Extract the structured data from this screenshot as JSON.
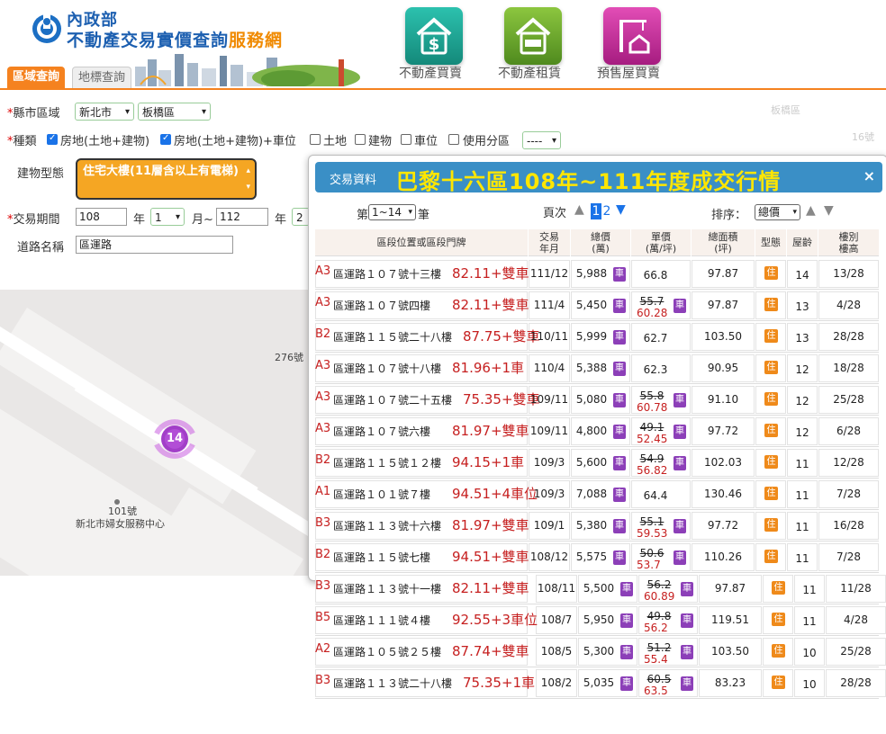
{
  "header": {
    "ministry": "內政部",
    "site_title_main": "不動產交易實價查詢",
    "site_title_suffix": "服務網",
    "categories": [
      {
        "label": "不動產買賣",
        "color": "#1aa08f"
      },
      {
        "label": "不動產租賃",
        "color": "#6aa624"
      },
      {
        "label": "預售屋買賣",
        "color": "#c9339d"
      }
    ],
    "tabs": [
      "區域查詢",
      "地標查詢"
    ]
  },
  "form": {
    "region_label": "縣市區域",
    "city": "新北市",
    "district": "板橋區",
    "type_label": "種類",
    "types": [
      {
        "label": "房地(土地+建物)",
        "checked": true
      },
      {
        "label": "房地(土地+建物)+車位",
        "checked": true
      },
      {
        "label": "土地",
        "checked": false
      },
      {
        "label": "建物",
        "checked": false
      },
      {
        "label": "車位",
        "checked": false
      },
      {
        "label": "使用分區",
        "checked": false
      }
    ],
    "zoning_value": "----",
    "building_type_label": "建物型態",
    "building_type_value": "住宅大樓(11層含以上有電梯)",
    "period_label": "交易期間",
    "period_start_year": "108",
    "period_year_unit": "年",
    "period_start_month": "1",
    "period_month_unit": "月~",
    "period_end_year": "112",
    "period_end_year_unit": "年",
    "period_end_month": "2",
    "road_label": "道路名稱",
    "road_value": "區運路"
  },
  "map": {
    "labels": [
      "276號",
      "101號",
      "新北市婦女服務中心"
    ],
    "cluster_count": "14",
    "faded_labels": [
      "板橋區",
      "16號"
    ]
  },
  "popup": {
    "tag": "交易資料",
    "title": "巴黎十六區108年~111年度成交行情",
    "close": "×",
    "range_prefix": "第",
    "range_value": "1~14",
    "range_suffix": "筆",
    "page_label": "頁次",
    "pages": [
      "1",
      "2"
    ],
    "sort_label": "排序：",
    "sort_value": "總價",
    "car_badge": "車",
    "res_badge": "住",
    "headers": [
      "區段位置或區段門牌",
      "交易\n年月",
      "總價\n(萬)",
      "單價\n(萬/坪)",
      "總面積\n(坪)",
      "型態",
      "屋齡",
      "樓別\n樓高"
    ],
    "rows": [
      {
        "code": "A3",
        "addr": "區運路１０７號十三樓",
        "ping": "82.11+雙車",
        "date": "111/12",
        "total": "5,988",
        "unit_orig": "66.8",
        "unit_adj": "",
        "area": "97.87",
        "age": "14",
        "floor": "13/28"
      },
      {
        "code": "A3",
        "addr": "區運路１０７號四樓",
        "ping": "82.11+雙車",
        "date": "111/4",
        "total": "5,450",
        "unit_orig": "55.7",
        "unit_adj": "60.28",
        "area": "97.87",
        "age": "13",
        "floor": "4/28"
      },
      {
        "code": "B2",
        "addr": "區運路１１５號二十八樓",
        "ping": "87.75+雙車",
        "date": "110/11",
        "total": "5,999",
        "unit_orig": "62.7",
        "unit_adj": "",
        "area": "103.50",
        "age": "13",
        "floor": "28/28"
      },
      {
        "code": "A3",
        "addr": "區運路１０７號十八樓",
        "ping": "81.96+1車",
        "date": "110/4",
        "total": "5,388",
        "unit_orig": "62.3",
        "unit_adj": "",
        "area": "90.95",
        "age": "12",
        "floor": "18/28"
      },
      {
        "code": "A3",
        "addr": "區運路１０７號二十五樓",
        "ping": "75.35+雙車",
        "date": "109/11",
        "total": "5,080",
        "unit_orig": "55.8",
        "unit_adj": "60.78",
        "area": "91.10",
        "age": "12",
        "floor": "25/28"
      },
      {
        "code": "A3",
        "addr": "區運路１０７號六樓",
        "ping": "81.97+雙車",
        "date": "109/11",
        "total": "4,800",
        "unit_orig": "49.1",
        "unit_adj": "52.45",
        "area": "97.72",
        "age": "12",
        "floor": "6/28"
      },
      {
        "code": "B2",
        "addr": "區運路１１５號１２樓",
        "ping": "94.15+1車",
        "date": "109/3",
        "total": "5,600",
        "unit_orig": "54.9",
        "unit_adj": "56.82",
        "area": "102.03",
        "age": "11",
        "floor": "12/28"
      },
      {
        "code": "A1",
        "addr": "區運路１０１號７樓",
        "ping": "94.51+4車位",
        "date": "109/3",
        "total": "7,088",
        "unit_orig": "64.4",
        "unit_adj": "",
        "area": "130.46",
        "age": "11",
        "floor": "7/28"
      },
      {
        "code": "B3",
        "addr": "區運路１１３號十六樓",
        "ping": "81.97+雙車",
        "date": "109/1",
        "total": "5,380",
        "unit_orig": "55.1",
        "unit_adj": "59.53",
        "area": "97.72",
        "age": "11",
        "floor": "16/28"
      },
      {
        "code": "B2",
        "addr": "區運路１１５號七樓",
        "ping": "94.51+雙車",
        "date": "108/12",
        "total": "5,575",
        "unit_orig": "50.6",
        "unit_adj": "53.7",
        "area": "110.26",
        "age": "11",
        "floor": "7/28"
      },
      {
        "code": "B3",
        "addr": "區運路１１３號十一樓",
        "ping": "82.11+雙車",
        "date": "108/11",
        "total": "5,500",
        "unit_orig": "56.2",
        "unit_adj": "60.89",
        "area": "97.87",
        "age": "11",
        "floor": "11/28"
      },
      {
        "code": "B5",
        "addr": "區運路１１１號４樓",
        "ping": "92.55+3車位",
        "date": "108/7",
        "total": "5,950",
        "unit_orig": "49.8",
        "unit_adj": "56.2",
        "area": "119.51",
        "age": "11",
        "floor": "4/28"
      },
      {
        "code": "A2",
        "addr": "區運路１０５號２５樓",
        "ping": "87.74+雙車",
        "date": "108/5",
        "total": "5,300",
        "unit_orig": "51.2",
        "unit_adj": "55.4",
        "area": "103.50",
        "age": "10",
        "floor": "25/28"
      },
      {
        "code": "B3",
        "addr": "區運路１１３號二十八樓",
        "ping": "75.35+1車",
        "date": "108/2",
        "total": "5,035",
        "unit_orig": "60.5",
        "unit_adj": "63.5",
        "area": "83.23",
        "age": "10",
        "floor": "28/28"
      }
    ]
  }
}
